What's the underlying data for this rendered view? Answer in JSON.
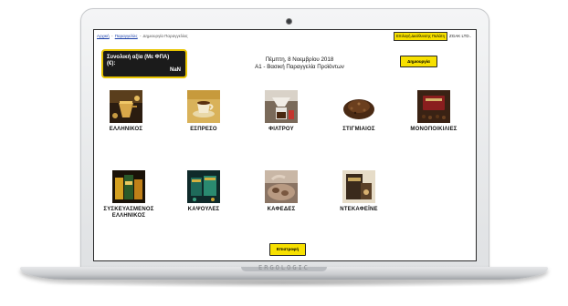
{
  "breadcrumb": {
    "items": [
      {
        "label": "Αρχική"
      },
      {
        "label": "Παραγγελίες"
      },
      {
        "label": "Δημιουργία Παραγγελίας"
      }
    ],
    "separator": "-"
  },
  "header": {
    "company_button_label": "Επιλογή Διεύθυνσης Παλάτη",
    "company_name": "ZGAK LTD..",
    "total_label": "Συνολική αξία (Με ΦΠΑ) (€):",
    "total_value": "NaN",
    "date_line": "Πέμπτη, 8 Νοεμβρίου 2018",
    "subtitle_line": "Α1 - Βασική Παραγγελία Προϊόντων",
    "create_button_label": "Δημιουργία"
  },
  "categories": [
    {
      "label": "ΕΛΛΗΝΙΚΟΣ",
      "icon": "greek-coffee-image"
    },
    {
      "label": "ΕΣΠΡΕΣΟ",
      "icon": "espresso-image"
    },
    {
      "label": "ΦΙΛΤΡΟΥ",
      "icon": "filter-coffee-image"
    },
    {
      "label": "ΣΤΙΓΜΙΑΙΟΣ",
      "icon": "instant-coffee-image"
    },
    {
      "label": "ΜΟΝΟΠΟΙΚΙΛΙΕΣ",
      "icon": "single-origin-image"
    },
    {
      "label": "ΣΥΣΚΕΥΑΣΜΕΝΟΣ ΕΛΛΗΝΙΚΟΣ",
      "icon": "packaged-greek-image"
    },
    {
      "label": "ΚΑΨΟΥΛΕΣ",
      "icon": "capsules-image"
    },
    {
      "label": "ΚΑΦΕΔΕΣ",
      "icon": "coffee-beans-image"
    },
    {
      "label": "ΝΤΕΚΑΦΕΪΝΕ",
      "icon": "decaf-image"
    }
  ],
  "footer": {
    "back_button_label": "Επιστροφή"
  },
  "device": {
    "brand": "ERGOLOGIC"
  },
  "colors": {
    "accent_yellow": "#f7e000",
    "total_box_bg": "#1b1b1b",
    "total_box_border": "#e8c400",
    "link_blue": "#1a3fa8"
  }
}
